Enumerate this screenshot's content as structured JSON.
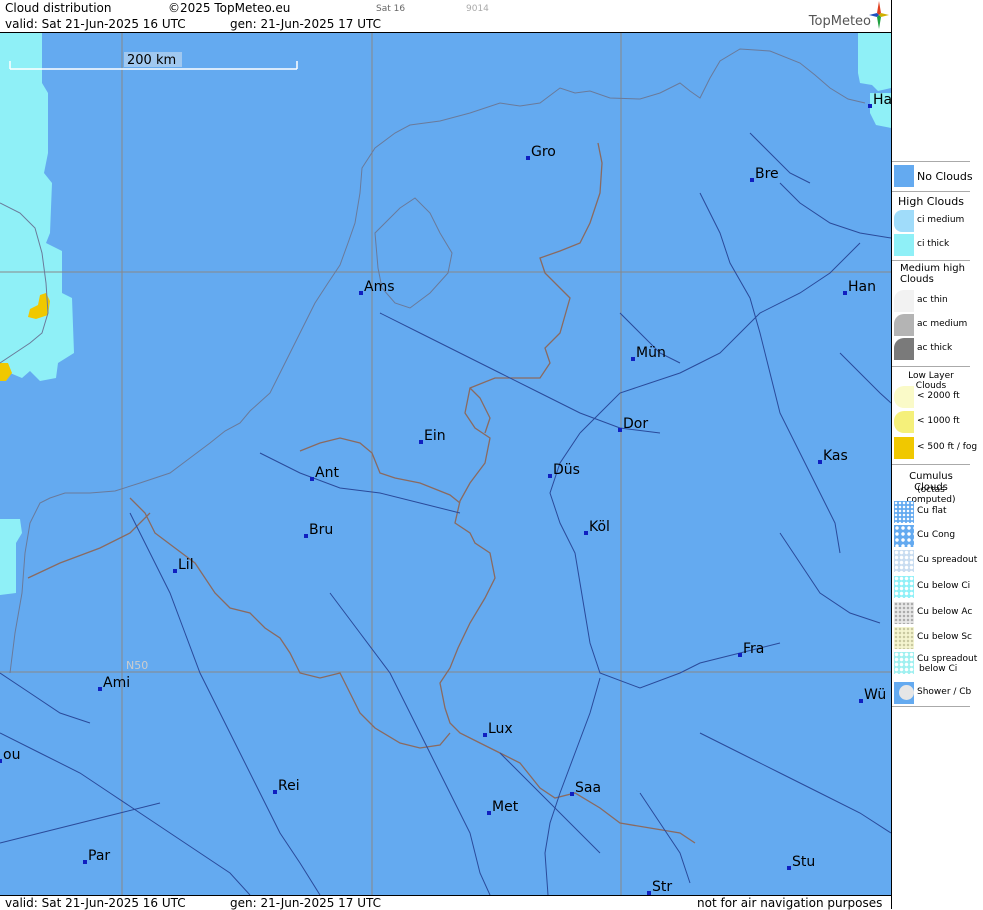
{
  "header": {
    "title": "Cloud distribution",
    "copyright": "©2025 TopMeteo.eu",
    "step": "Sat 16",
    "code": "9014",
    "valid": "valid:  Sat  21-Jun-2025  16 UTC",
    "generated": "gen: 21-Jun-2025 17 UTC",
    "brand": "TopMeteo"
  },
  "footer": {
    "valid": "valid:  Sat  21-Jun-2025  16 UTC",
    "generated": "gen: 21-Jun-2025 17 UTC",
    "disclaimer": "not for air navigation purposes"
  },
  "scale": {
    "label": "200 km"
  },
  "grid": {
    "lat_label": "N50"
  },
  "colors": {
    "no_clouds": "#64aaf0",
    "ci_medium": "#a0dcfa",
    "ci_thick": "#8ff0f7",
    "fog": "#f0c800",
    "city_marker": "#1020c0",
    "borders": "#8a6a60",
    "rivers": "#2a4a9a"
  },
  "cities": [
    {
      "name": "Gro"
    },
    {
      "name": "Bre"
    },
    {
      "name": "Ha"
    },
    {
      "name": "Ams"
    },
    {
      "name": "Han"
    },
    {
      "name": "Mün"
    },
    {
      "name": "Ein"
    },
    {
      "name": "Dor"
    },
    {
      "name": "Ant"
    },
    {
      "name": "Düs"
    },
    {
      "name": "Kas"
    },
    {
      "name": "Bru"
    },
    {
      "name": "Köl"
    },
    {
      "name": "Lil"
    },
    {
      "name": "Fra"
    },
    {
      "name": "Ami"
    },
    {
      "name": "Wü"
    },
    {
      "name": "Lux"
    },
    {
      "name": "ou"
    },
    {
      "name": "Rei"
    },
    {
      "name": "Saa"
    },
    {
      "name": "Met"
    },
    {
      "name": "Par"
    },
    {
      "name": "Stu"
    },
    {
      "name": "Str"
    }
  ],
  "legend": {
    "no_clouds": "No Clouds",
    "high_title": "High Clouds",
    "ci_medium": "ci medium",
    "ci_thick": "ci thick",
    "medium_title_1": "Medium high",
    "medium_title_2": "Clouds",
    "ac_thin": "ac thin",
    "ac_medium": "ac medium",
    "ac_thick": "ac thick",
    "low_title": "Low Layer Clouds",
    "low_2000": "< 2000 ft",
    "low_1000": "< 1000 ft",
    "low_500": "< 500 ft / fog",
    "cu_title": "Cumulus Clouds",
    "cu_sub": "(octas computed)",
    "cu_flat": "Cu flat",
    "cu_cong": "Cu Cong",
    "cu_spread": "Cu spreadout",
    "cu_below_ci": "Cu below Ci",
    "cu_below_ac": "Cu below Ac",
    "cu_below_sc": "Cu below Sc",
    "cu_spread_ci_1": "Cu spreadout",
    "cu_spread_ci_2": "below Ci",
    "shower": "Shower / Cb"
  }
}
